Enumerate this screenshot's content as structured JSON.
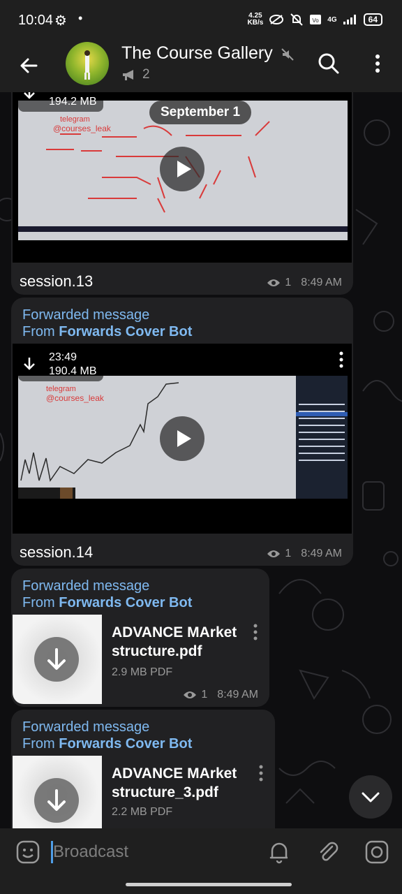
{
  "status_bar": {
    "time": "10:04",
    "net_speed_value": "4.25",
    "net_speed_unit": "KB/s",
    "network": "4G",
    "battery": "64"
  },
  "header": {
    "title": "The Course Gallery",
    "subscriber_count": "2"
  },
  "date_separator": "September 1",
  "messages": [
    {
      "type": "video",
      "size": "194.2 MB",
      "caption": "session.13",
      "views": "1",
      "time": "8:49 AM"
    },
    {
      "type": "video",
      "forward_label": "Forwarded message",
      "from_prefix": "From",
      "from_name": "Forwards Cover Bot",
      "duration": "23:49",
      "size": "190.4 MB",
      "caption": "session.14",
      "views": "1",
      "time": "8:49 AM"
    },
    {
      "type": "document",
      "forward_label": "Forwarded message",
      "from_prefix": "From",
      "from_name": "Forwards Cover Bot",
      "file_name_line1": "ADVANCE MArket",
      "file_name_line2": "structure.pdf",
      "file_info": "2.9 MB PDF",
      "views": "1",
      "time": "8:49 AM"
    },
    {
      "type": "document",
      "forward_label": "Forwarded message",
      "from_prefix": "From",
      "from_name": "Forwards Cover Bot",
      "file_name_line1": "ADVANCE MArket",
      "file_name_line2": "structure_3.pdf",
      "file_info": "2.2 MB PDF"
    }
  ],
  "video_overlay": {
    "watermark_line1": "telegram",
    "watermark_line2": "@courses_leak"
  },
  "composer": {
    "placeholder": "Broadcast"
  },
  "colors": {
    "accent": "#7fb9f0",
    "bubble": "#212123",
    "bar": "#1f1f1f"
  }
}
